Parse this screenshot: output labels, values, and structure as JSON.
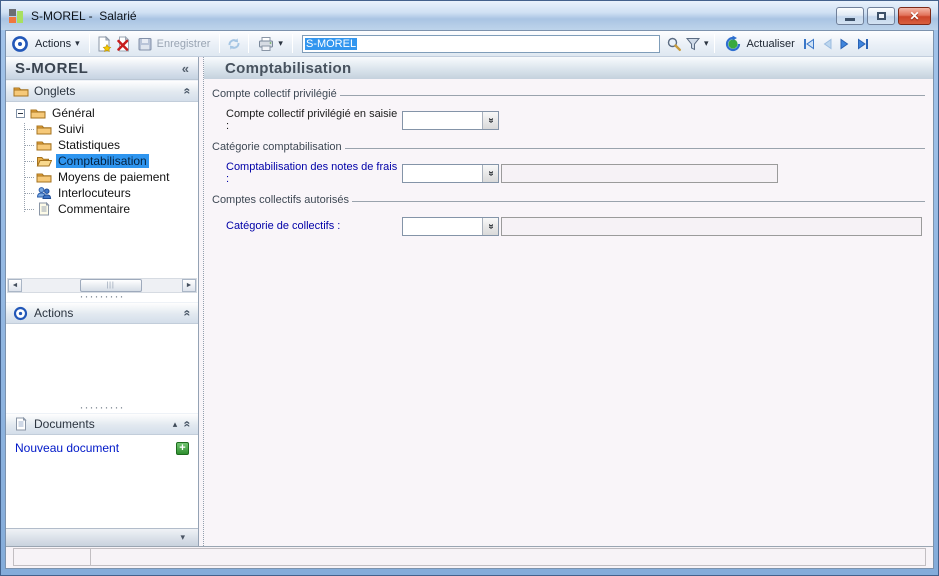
{
  "titlebar": {
    "title": "S-MOREL -  Salarié"
  },
  "toolbar": {
    "actions_label": "Actions",
    "save_label": "Enregistrer",
    "search_value": "S-MOREL",
    "refresh_label": "Actualiser"
  },
  "sidebar": {
    "title": "S-MOREL",
    "onglets_label": "Onglets",
    "actions_label": "Actions",
    "documents_label": "Documents",
    "new_document_label": "Nouveau document",
    "tree_root": "Général",
    "tree": [
      {
        "label": "Suivi",
        "icon": "folder-icon"
      },
      {
        "label": "Statistiques",
        "icon": "folder-icon"
      },
      {
        "label": "Comptabilisation",
        "icon": "folder-open-icon",
        "selected": true
      },
      {
        "label": "Moyens de paiement",
        "icon": "folder-icon"
      },
      {
        "label": "Interlocuteurs",
        "icon": "people-icon"
      },
      {
        "label": "Commentaire",
        "icon": "note-icon"
      }
    ]
  },
  "main": {
    "title": "Comptabilisation",
    "group1": {
      "legend": "Compte collectif privilégié",
      "field_label": "Compte collectif privilégié en saisie :",
      "value": ""
    },
    "group2": {
      "legend": "Catégorie comptabilisation",
      "field_label": "Comptabilisation des notes de frais :",
      "value": ""
    },
    "group3": {
      "legend": "Comptes collectifs autorisés",
      "field_label": "Catégorie de collectifs :",
      "value": ""
    }
  },
  "status": {
    "cell1": "",
    "cell2": ""
  },
  "glyphs": {
    "chevron_double": "«",
    "triangle_up": "▴",
    "triangle_down": "▾",
    "dots": "·········",
    "grip": "|||",
    "close": "✕",
    "scroll_left": "◄",
    "scroll_right": "►"
  },
  "colors": {
    "selection_blue": "#2e95ef",
    "link_blue": "#0018c8",
    "field_label_blue": "#0000a8",
    "close_button_red": "#cc4429",
    "plus_green": "#2e8f2e",
    "titlebar_blue": "#a9c4e3"
  }
}
